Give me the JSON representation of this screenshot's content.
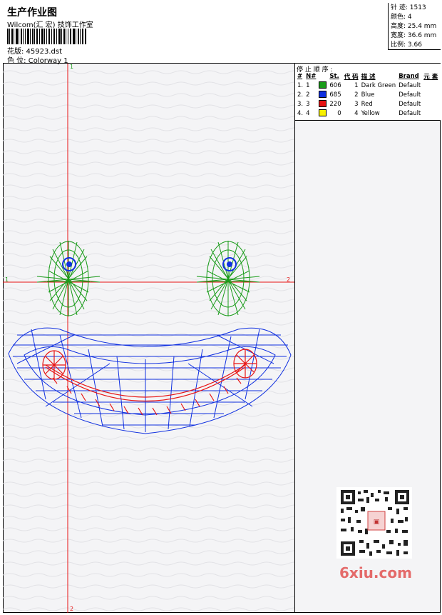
{
  "header": {
    "title": "生产作业图",
    "subtitle": "Wilcom(汇 宏) 技饰工作室",
    "design_label": "花版: 45923.dst",
    "colorway_label": "色 位:  Colorway 1"
  },
  "stats": {
    "stitches": "针 迹:  1513",
    "colors": "颜色:  4",
    "height": "高度:  25.4 mm",
    "width": "宽度:  36.6 mm",
    "scale": "比例:  3.66"
  },
  "panel": {
    "title": "停 止 顺 序 :",
    "columns": [
      "#",
      "N#",
      "St.",
      "代 码",
      "描 述",
      "Brand",
      "元 素"
    ],
    "rows": [
      {
        "idx": "1.",
        "n": "1",
        "color": "#1a9c1a",
        "st": "606",
        "code": "1",
        "desc": "Dark Green",
        "brand": "Default"
      },
      {
        "idx": "2.",
        "n": "2",
        "color": "#1030e0",
        "st": "685",
        "code": "2",
        "desc": "Blue",
        "brand": "Default"
      },
      {
        "idx": "3.",
        "n": "3",
        "color": "#e81414",
        "st": "220",
        "code": "3",
        "desc": "Red",
        "brand": "Default"
      },
      {
        "idx": "4.",
        "n": "4",
        "color": "#f8f000",
        "st": "0",
        "code": "4",
        "desc": "Yellow",
        "brand": "Default"
      }
    ]
  },
  "guides": {
    "top": "1",
    "bottom": "2",
    "left": "1",
    "right": "2",
    "line_color": "#e81414"
  },
  "watermark": {
    "text": "6xiu.com",
    "color": "#e46a6a"
  }
}
